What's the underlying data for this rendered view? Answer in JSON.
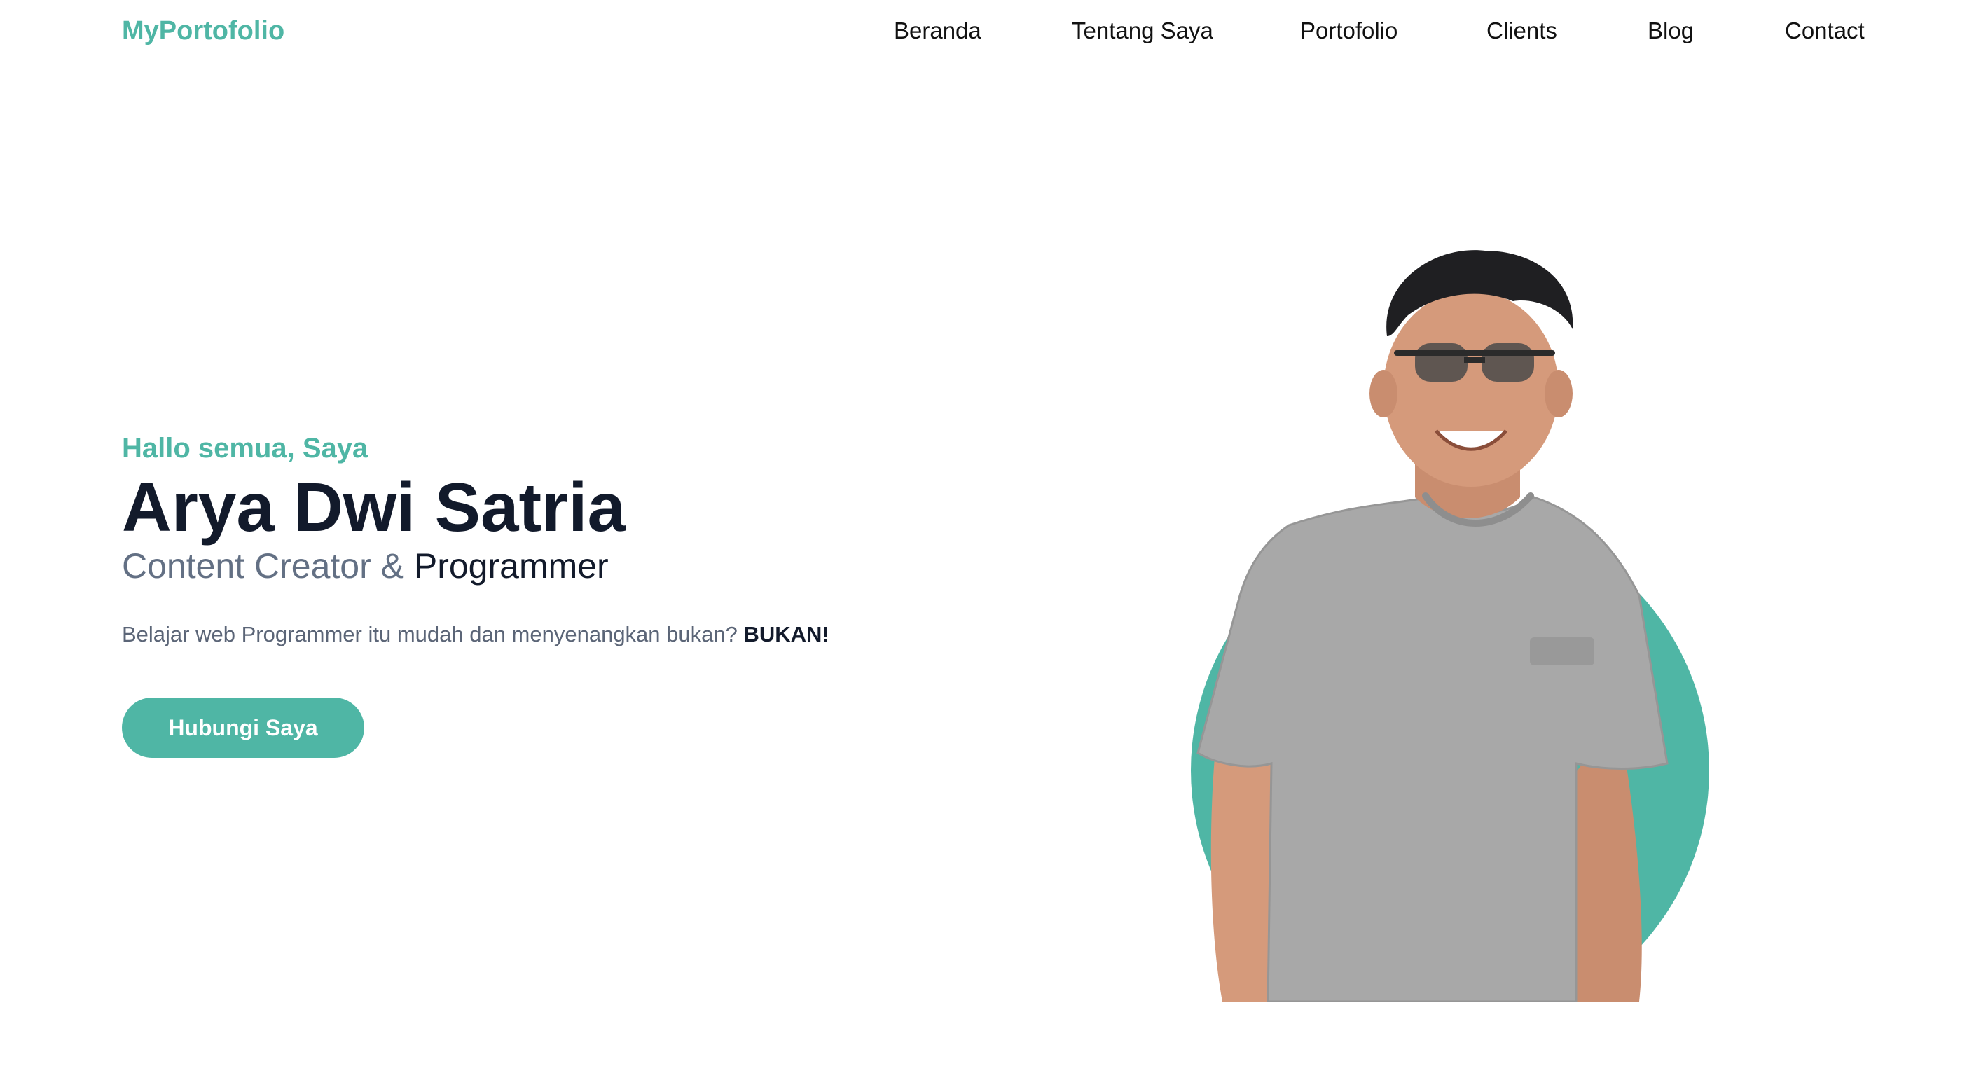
{
  "header": {
    "brand": "MyPortofolio",
    "nav": [
      {
        "label": "Beranda"
      },
      {
        "label": "Tentang Saya"
      },
      {
        "label": "Portofolio"
      },
      {
        "label": "Clients"
      },
      {
        "label": "Blog"
      },
      {
        "label": "Contact"
      }
    ]
  },
  "hero": {
    "greeting": "Hallo semua, Saya",
    "name": "Arya Dwi Satria",
    "role_prefix": "Content Creator & ",
    "role_highlight": "Programmer",
    "tagline": "Belajar web Programmer itu mudah dan menyenangkan bukan? ",
    "tagline_emphasis": "BUKAN!",
    "cta_label": "Hubungi Saya"
  },
  "colors": {
    "accent": "#4fb6a5",
    "heading": "#121a2b",
    "muted": "#637084",
    "shirt": "#a8a8a8",
    "skin": "#d59a7b",
    "hair": "#1f1f22"
  },
  "icons": {
    "photo": "profile-photo"
  }
}
